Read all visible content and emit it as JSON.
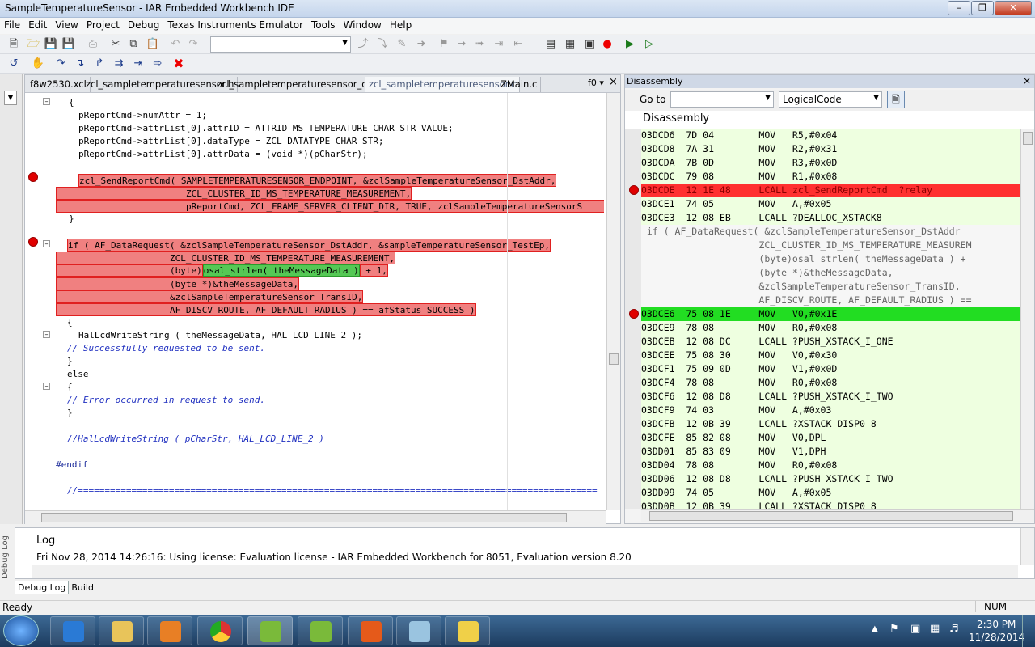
{
  "window": {
    "title": "SampleTemperatureSensor - IAR Embedded Workbench IDE"
  },
  "menu": [
    "File",
    "Edit",
    "View",
    "Project",
    "Debug",
    "Texas Instruments Emulator",
    "Tools",
    "Window",
    "Help"
  ],
  "editor": {
    "tabs": [
      "f8w2530.xcl",
      "zcl_sampletemperaturesensor.h",
      "zcl_sampletemperaturesensor_data.c",
      "zcl_sampletemperaturesensor.c",
      "ZMain.c"
    ],
    "active_tab_index": 3,
    "tab_menu": "f0 ▾",
    "close": "×",
    "lines": {
      "l1": "{",
      "l2": "pReportCmd->numAttr = 1;",
      "l3": "pReportCmd->attrList[0].attrID = ATTRID_MS_TEMPERATURE_CHAR_STR_VALUE;",
      "l4": "pReportCmd->attrList[0].dataType = ZCL_DATATYPE_CHAR_STR;",
      "l5": "pReportCmd->attrList[0].attrData = (void *)(pCharStr);",
      "l7": "zcl_SendReportCmd( SAMPLETEMPERATURESENSOR_ENDPOINT, &zclSampleTemperatureSensor_DstAddr,",
      "l8": "ZCL_CLUSTER_ID_MS_TEMPERATURE_MEASUREMENT,",
      "l9": "pReportCmd, ZCL_FRAME_SERVER_CLIENT_DIR, TRUE, zclSampleTemperatureSensorS",
      "l10": "}",
      "l12": "if ( AF_DataRequest( &zclSampleTemperatureSensor_DstAddr, &sampleTemperatureSensor_TestEp,",
      "l13": "ZCL_CLUSTER_ID_MS_TEMPERATURE_MEASUREMENT,",
      "l14a": "(byte)",
      "l14b": "osal_strlen( theMessageData )",
      "l14c": " + 1,",
      "l15": "(byte *)&theMessageData,",
      "l16": "&zclSampleTemperatureSensor_TransID,",
      "l17": "AF_DISCV_ROUTE, AF_DEFAULT_RADIUS ) == afStatus_SUCCESS )",
      "l18": "{",
      "l19": "HalLcdWriteString ( theMessageData, HAL_LCD_LINE_2 );",
      "l20": "// Successfully requested to be sent.",
      "l21": "}",
      "l22": "else",
      "l23": "{",
      "l24": "// Error occurred in request to send.",
      "l25": "}",
      "l27": "//HalLcdWriteString ( pCharStr, HAL_LCD_LINE_2 )",
      "l29": "#endif",
      "l31": "//================================================================================================="
    }
  },
  "disassembly": {
    "header": "Disassembly",
    "goto_label": "Go to",
    "goto_value": "",
    "mode": "LogicalCode",
    "title": "Disassembly",
    "rows": [
      {
        "t": "code",
        "text": "03DCD6  7D 04        MOV   R5,#0x04"
      },
      {
        "t": "code",
        "text": "03DCD8  7A 31        MOV   R2,#0x31"
      },
      {
        "t": "code",
        "text": "03DCDA  7B 0D        MOV   R3,#0x0D"
      },
      {
        "t": "code",
        "text": "03DCDC  79 08        MOV   R1,#0x08"
      },
      {
        "t": "red",
        "text": "03DCDE  12 1E 48     LCALL zcl_SendReportCmd  ?relay"
      },
      {
        "t": "code",
        "text": "03DCE1  74 05        MOV   A,#0x05"
      },
      {
        "t": "code",
        "text": "03DCE3  12 08 EB     LCALL ?DEALLOC_XSTACK8"
      },
      {
        "t": "src",
        "text": " if ( AF_DataRequest( &zclSampleTemperatureSensor_DstAddr"
      },
      {
        "t": "src",
        "text": "                     ZCL_CLUSTER_ID_MS_TEMPERATURE_MEASUREM"
      },
      {
        "t": "src",
        "text": "                     (byte)osal_strlen( theMessageData ) +"
      },
      {
        "t": "src",
        "text": "                     (byte *)&theMessageData,"
      },
      {
        "t": "src",
        "text": "                     &zclSampleTemperatureSensor_TransID,"
      },
      {
        "t": "src",
        "text": "                     AF_DISCV_ROUTE, AF_DEFAULT_RADIUS ) =="
      },
      {
        "t": "grn",
        "text": "03DCE6  75 08 1E     MOV   V0,#0x1E"
      },
      {
        "t": "code",
        "text": "03DCE9  78 08        MOV   R0,#0x08"
      },
      {
        "t": "code",
        "text": "03DCEB  12 08 DC     LCALL ?PUSH_XSTACK_I_ONE"
      },
      {
        "t": "code",
        "text": "03DCEE  75 08 30     MOV   V0,#0x30"
      },
      {
        "t": "code",
        "text": "03DCF1  75 09 0D     MOV   V1,#0x0D"
      },
      {
        "t": "code",
        "text": "03DCF4  78 08        MOV   R0,#0x08"
      },
      {
        "t": "code",
        "text": "03DCF6  12 08 D8     LCALL ?PUSH_XSTACK_I_TWO"
      },
      {
        "t": "code",
        "text": "03DCF9  74 03        MOV   A,#0x03"
      },
      {
        "t": "code",
        "text": "03DCFB  12 0B 39     LCALL ?XSTACK_DISP0_8"
      },
      {
        "t": "code",
        "text": "03DCFE  85 82 08     MOV   V0,DPL"
      },
      {
        "t": "code",
        "text": "03DD01  85 83 09     MOV   V1,DPH"
      },
      {
        "t": "code",
        "text": "03DD04  78 08        MOV   R0,#0x08"
      },
      {
        "t": "code",
        "text": "03DD06  12 08 D8     LCALL ?PUSH_XSTACK_I_TWO"
      },
      {
        "t": "code",
        "text": "03DD09  74 05        MOV   A,#0x05"
      },
      {
        "t": "code",
        "text": "03DD0B  12 0B 39     LCALL ?XSTACK_DISP0_8"
      }
    ]
  },
  "log": {
    "side_label": "Debug Log",
    "title": "Log",
    "message": "Fri Nov 28, 2014 14:26:16: Using license: Evaluation license - IAR Embedded Workbench for 8051, Evaluation version 8.20",
    "tabs": [
      "Debug Log",
      "Build"
    ]
  },
  "status": {
    "left": "Ready",
    "right": "NUM"
  },
  "taskbar": {
    "time": "2:30 PM",
    "date": "11/28/2014"
  }
}
